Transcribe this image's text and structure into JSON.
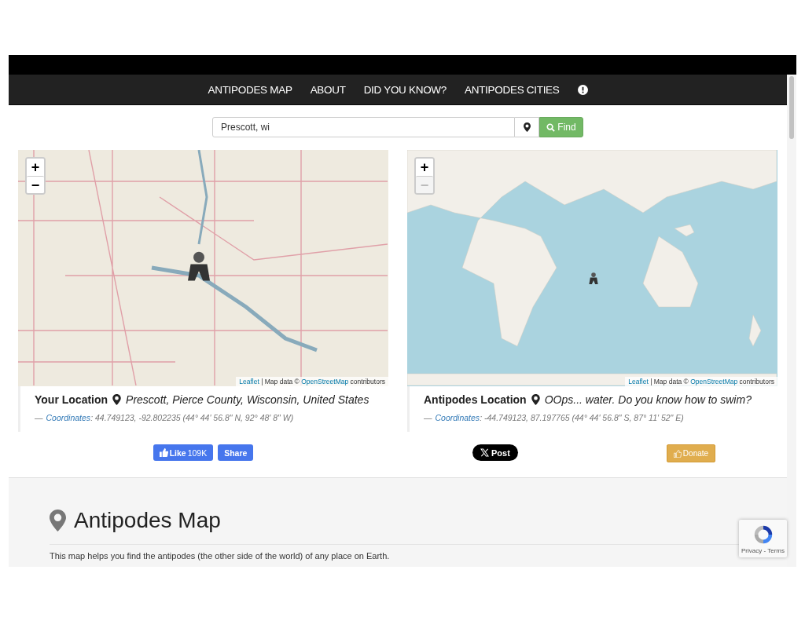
{
  "nav": {
    "items": [
      {
        "label": "ANTIPODES MAP"
      },
      {
        "label": "ABOUT"
      },
      {
        "label": "DID YOU KNOW?"
      },
      {
        "label": "ANTIPODES CITIES"
      }
    ]
  },
  "search": {
    "value": "Prescott, wi",
    "button": "Find"
  },
  "maps": [
    {
      "kind": "land",
      "zoom_in": "+",
      "zoom_out": "−",
      "dash": "—",
      "attribution_link": "Leaflet",
      "attribution_text": "| Map data ©",
      "attribution_source": "OpenStreetMap",
      "attribution_tail": "contributors",
      "zoom_out_disabled": false,
      "title": "Your Location",
      "place": "Prescott, Pierce County, Wisconsin, United States",
      "coords_label": "Coordinates",
      "coords": ": 44.749123, -92.802235 (44° 44' 56.8\" N, 92° 48' 8\" W)"
    },
    {
      "kind": "world",
      "zoom_in": "+",
      "zoom_out": "−",
      "dash": "—",
      "attribution_link": "Leaflet",
      "attribution_text": "| Map data ©",
      "attribution_source": "OpenStreetMap",
      "attribution_tail": "contributors",
      "zoom_out_disabled": true,
      "title": "Antipodes Location",
      "place": "OOps... water. Do you know how to swim?",
      "coords_label": "Coordinates",
      "coords": ": -44.749123, 87.197765 (44° 44' 56.8\" S, 87° 11' 52\" E)"
    }
  ],
  "social": {
    "like": "Like",
    "like_count": "109K",
    "share": "Share",
    "post": "Post",
    "donate": "Donate"
  },
  "section": {
    "heading": "Antipodes Map",
    "text": "This map helps you find the antipodes (the other side of the world) of any place on Earth."
  },
  "recaptcha": {
    "text": "Privacy - Terms"
  }
}
